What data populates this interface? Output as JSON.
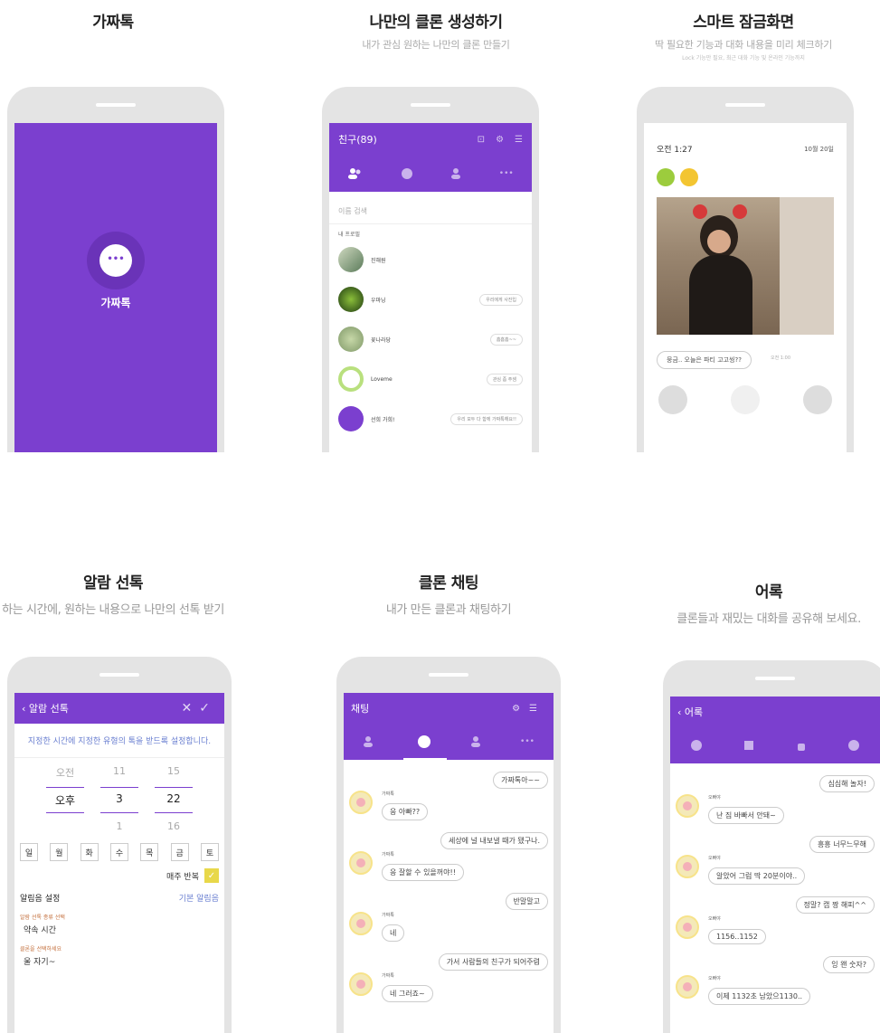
{
  "sections": {
    "gazzatok": {
      "title": "가짜톡",
      "app_name": "가짜톡"
    },
    "clone_create": {
      "title": "나만의 클론 생성하기",
      "subtitle": "내가 관심 원하는 나만의 클론 만들기",
      "header": "친구(89)",
      "search_placeholder": "이름 검색",
      "section_label": "내 프로필",
      "friends": [
        {
          "name": "진해원",
          "status": ""
        },
        {
          "name": "우마닝",
          "status": "우리에게 사진입"
        },
        {
          "name": "꽃나라당",
          "status": "흠흠흠~~"
        },
        {
          "name": "Loveme",
          "status": "관심 좀 주셈"
        },
        {
          "name": "선희 가희!",
          "status": "우리 모두 다 함께 가짜톡해요!!"
        }
      ]
    },
    "lock_screen": {
      "title": "스마트 잠금화면",
      "subtitle": "딱 필요한 기능과 대화 내용을 미리 체크하기",
      "subtitle_small": "Lock 기능만 필요, 최근 대화 기능 및 온라인 기능까지",
      "time": "오전 1:27",
      "date": "10월 20일",
      "bubble": "뭉금.. 오늘은 파티 고고씽??",
      "bubble_time": "오전 1:00"
    },
    "alarm": {
      "title": "알람 선톡",
      "subtitle": "하는 시간에, 원하는 내용으로 나만의 선톡 받기",
      "header": "알람 선톡",
      "info": "지정한 시간에 지정한 유형의 톡을 받드록 설정합니다.",
      "picker_prev": [
        "오전",
        "11",
        "15"
      ],
      "picker_sel": [
        "오후",
        "3",
        ":",
        "22"
      ],
      "picker_next": [
        "",
        "1",
        "16"
      ],
      "days": [
        "일",
        "월",
        "화",
        "수",
        "목",
        "금",
        "토"
      ],
      "repeat_label": "매주 반복",
      "alarm_sound_label": "알림음 설정",
      "alarm_sound_value": "기본 알림음",
      "type_label": "알람 선톡 종류 선택",
      "type_value": "약속 시간",
      "clone_label": "클론을 선택하세요",
      "clone_value": "울 자기~"
    },
    "clone_chat": {
      "title": "클론 채팅",
      "subtitle": "내가 만든 클론과 채팅하기",
      "header": "채팅",
      "messages": [
        {
          "side": "right",
          "text": "가짜톡아~~"
        },
        {
          "side": "left",
          "name": "가짜톡",
          "text": "응 아빠??"
        },
        {
          "side": "right",
          "text": "세상에 널 내보낼 때가 됐구나."
        },
        {
          "side": "left",
          "name": "가짜톡",
          "text": "응 잘할 수 있을꺼야!!"
        },
        {
          "side": "right",
          "text": "반말말고"
        },
        {
          "side": "left",
          "name": "가짜톡",
          "text": "네"
        },
        {
          "side": "right",
          "text": "가서 사람들의 친구가 되어주렴"
        },
        {
          "side": "left",
          "name": "가짜톡",
          "text": "네 그러죠~"
        }
      ]
    },
    "quotes": {
      "title": "어록",
      "subtitle": "클론들과 재밌는 대화를 공유해 보세요.",
      "header": "어록",
      "messages": [
        {
          "side": "right",
          "text": "심심해 놀자!"
        },
        {
          "side": "left",
          "name": "오빠야",
          "text": "난 짐 바빠서 안돼~"
        },
        {
          "side": "right",
          "text": "흥흥 너무느무해"
        },
        {
          "side": "left",
          "name": "오빠야",
          "text": "알았어 그럼 딱 20분이야.."
        },
        {
          "side": "right",
          "text": "정말? 캡 짱 해피^^"
        },
        {
          "side": "left",
          "name": "오빠야",
          "text": "1156..1152"
        },
        {
          "side": "right",
          "text": "잉 왠 숫자?"
        },
        {
          "side": "left",
          "name": "오빠야",
          "text": "이제 1132초 남았으1130.."
        }
      ]
    }
  },
  "colors": {
    "accent": "#7b3fcf",
    "link": "#6a7fd0",
    "check": "#e8d84a"
  },
  "icons": [
    "chat-bubble-icon",
    "friends-icon",
    "person-icon",
    "more-icon",
    "settings-icon",
    "menu-icon",
    "close-icon",
    "check-icon",
    "back-chevron-icon",
    "clock-icon",
    "thumbs-up-icon",
    "search-icon",
    "lock-icon"
  ]
}
